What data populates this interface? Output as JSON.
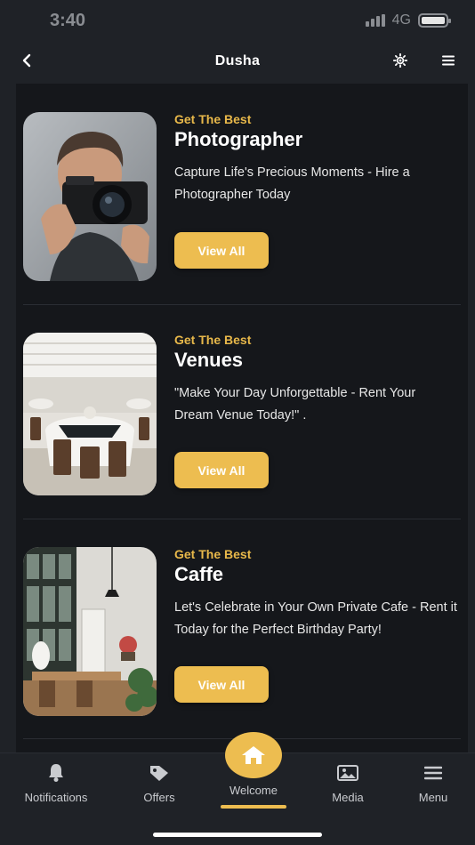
{
  "status": {
    "time": "3:40",
    "network": "4G"
  },
  "header": {
    "title": "Dusha"
  },
  "cards": [
    {
      "eyebrow": "Get The Best",
      "title": "Photographer",
      "description": "Capture Life's Precious Moments - Hire a Photographer Today",
      "button": "View All"
    },
    {
      "eyebrow": "Get The Best",
      "title": "Venues",
      "description": "\"Make Your Day Unforgettable - Rent Your Dream Venue Today!\" .",
      "button": "View All"
    },
    {
      "eyebrow": "Get The Best",
      "title": "Caffe",
      "description": "Let's Celebrate in Your Own Private Cafe - Rent it Today for the Perfect Birthday Party!",
      "button": "View All"
    }
  ],
  "nav": {
    "notifications": "Notifications",
    "offers": "Offers",
    "welcome": "Welcome",
    "media": "Media",
    "menu": "Menu"
  },
  "colors": {
    "accent": "#edbd50",
    "eyebrow": "#e8b84a",
    "background": "#1f2227",
    "panel": "#15171b"
  },
  "icons": [
    "back-icon",
    "sun-icon",
    "hamburger-icon",
    "bell-icon",
    "tag-icon",
    "home-icon",
    "image-icon",
    "menu-icon"
  ]
}
